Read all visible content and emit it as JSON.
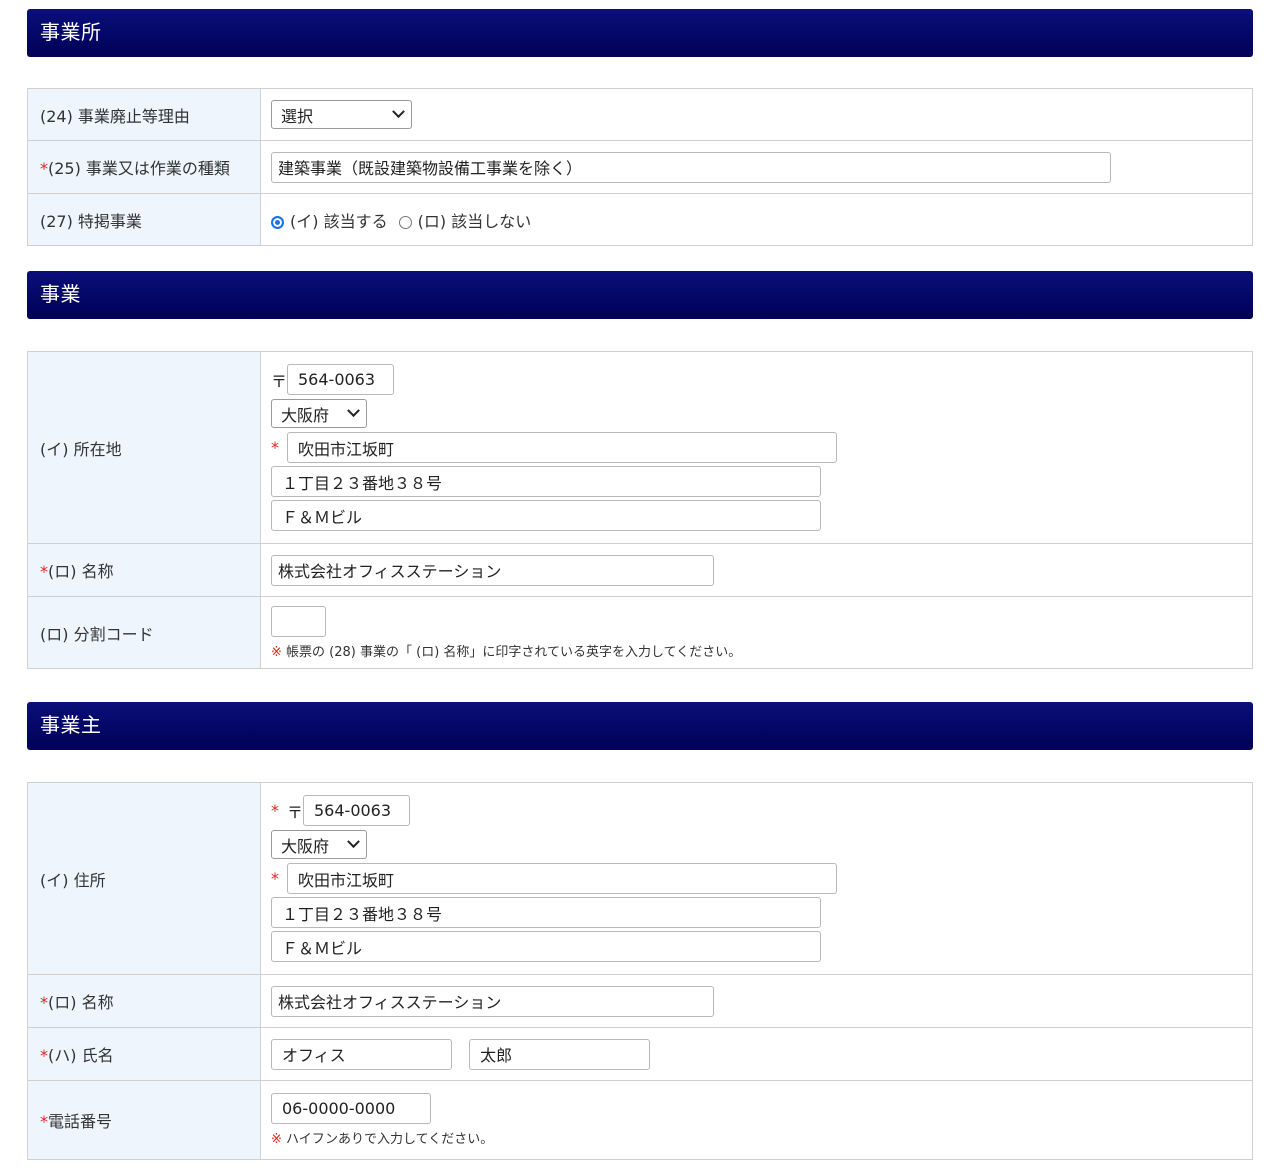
{
  "sections": {
    "office": {
      "title": "事業所",
      "rows": {
        "closure_reason": {
          "label": "(24) 事業廃止等理由",
          "select_value": "選択"
        },
        "business_type": {
          "required": "*",
          "label": "(25) 事業又は作業の種類",
          "value": "建築事業（既設建築物設備工事業を除く）"
        },
        "special": {
          "label": "(27) 特掲事業",
          "option_yes": "(イ) 該当する",
          "option_no": "(ロ) 該当しない"
        }
      }
    },
    "business": {
      "title": "事業",
      "rows": {
        "location": {
          "label": "(イ) 所在地",
          "postal_mark": "〒",
          "postal_code": "564-0063",
          "prefecture": "大阪府",
          "required": "*",
          "city": "吹田市江坂町",
          "address1": "１丁目２３番地３８号",
          "address2": "Ｆ＆Ｍビル"
        },
        "name": {
          "required": "*",
          "label": "(ロ) 名称",
          "value": "株式会社オフィスステーション"
        },
        "division_code": {
          "label": "(ロ) 分割コード",
          "value": "",
          "note_mark": "※",
          "note": "帳票の (28) 事業の「 (ロ) 名称」に印字されている英字を入力してください。"
        }
      }
    },
    "owner": {
      "title": "事業主",
      "rows": {
        "address": {
          "label": "(イ) 住所",
          "required": "*",
          "postal_mark": "〒",
          "postal_code": "564-0063",
          "prefecture": "大阪府",
          "city_required": "*",
          "city": "吹田市江坂町",
          "address1": "１丁目２３番地３８号",
          "address2": "Ｆ＆Ｍビル"
        },
        "name": {
          "required": "*",
          "label": "(ロ) 名称",
          "value": "株式会社オフィスステーション"
        },
        "person": {
          "required": "*",
          "label": "(ハ) 氏名",
          "last_name": "オフィス",
          "first_name": "太郎"
        },
        "phone": {
          "required": "*",
          "label": "電話番号",
          "value": "06-0000-0000",
          "note_mark": "※",
          "note": "ハイフンありで入力してください。"
        }
      }
    }
  },
  "colors": {
    "header": "#000055",
    "label_bg": "#eef5fd",
    "required": "#d9261c",
    "radio": "#1a73e8"
  }
}
